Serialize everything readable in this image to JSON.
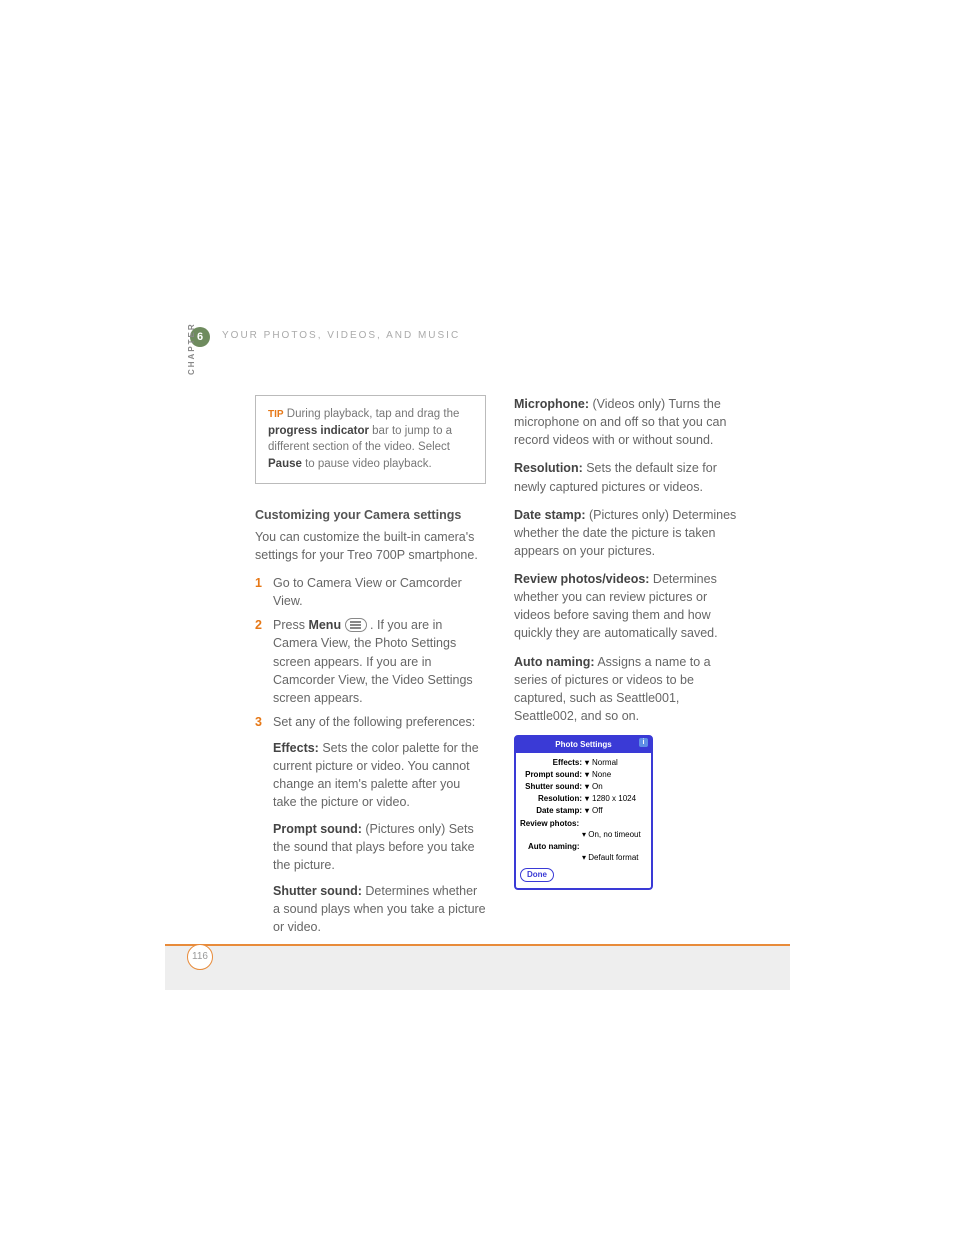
{
  "chapter_num": "6",
  "chapter_label": "CHAPTER",
  "header": "YOUR PHOTOS, VIDEOS, AND MUSIC",
  "tip": {
    "label": "TIP",
    "parts": [
      "During playback, tap and drag the ",
      "progress indicator",
      " bar to jump to a different section of the video. Select ",
      "Pause",
      " to pause video playback."
    ]
  },
  "subhead": "Customizing your Camera settings",
  "intro": "You can customize the built-in camera's settings for your Treo 700P smartphone.",
  "steps": [
    {
      "num": "1",
      "body_plain": "Go to Camera View or Camcorder View."
    },
    {
      "num": "2",
      "body_pre": "Press ",
      "body_bold": "Menu",
      "body_post": " . If you are in Camera View, the Photo Settings screen appears. If you are in Camcorder View, the Video Settings screen appears."
    },
    {
      "num": "3",
      "body_plain": "Set any of the following preferences:"
    }
  ],
  "defs_left": [
    {
      "term": "Effects:",
      "desc": " Sets the color palette for the current picture or video. You cannot change an item's palette after you take the picture or video."
    },
    {
      "term": "Prompt sound:",
      "desc": " (Pictures only) Sets the sound that plays before you take the picture."
    },
    {
      "term": "Shutter sound:",
      "desc": " Determines whether a sound plays when you take a picture or video."
    }
  ],
  "defs_right": [
    {
      "term": "Microphone:",
      "desc": " (Videos only) Turns the microphone on and off so that you can record videos with or without sound."
    },
    {
      "term": "Resolution:",
      "desc": " Sets the default size for newly captured pictures or videos."
    },
    {
      "term": "Date stamp:",
      "desc": " (Pictures only) Determines whether the date the picture is taken appears on your pictures."
    },
    {
      "term": "Review photos/videos:",
      "desc": " Determines whether you can review pictures or videos before saving them and how quickly they are automatically saved."
    },
    {
      "term": "Auto naming:",
      "desc": " Assigns a name to a series of pictures or videos to be captured, such as Seattle001, Seattle002, and so on."
    }
  ],
  "screenshot": {
    "title": "Photo Settings",
    "rows": [
      {
        "label": "Effects:",
        "value": "Normal"
      },
      {
        "label": "Prompt sound:",
        "value": "None"
      },
      {
        "label": "Shutter sound:",
        "value": "On"
      },
      {
        "label": "Resolution:",
        "value": "1280 x 1024"
      },
      {
        "label": "Date stamp:",
        "value": "Off"
      }
    ],
    "review_label": "Review photos:",
    "review_value": "On, no timeout",
    "auto_label": "Auto naming:",
    "auto_value": "Default format",
    "done": "Done"
  },
  "page_num": "116"
}
